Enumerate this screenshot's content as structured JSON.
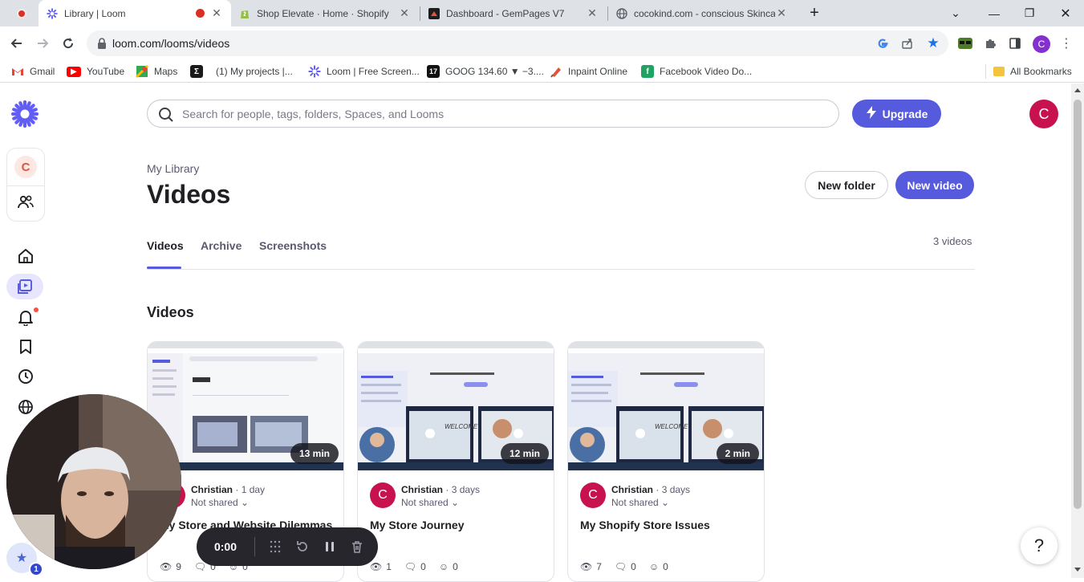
{
  "browser": {
    "tabs": [
      {
        "title": "Library | Loom",
        "active": true,
        "recording": true
      },
      {
        "title": "Shop Elevate · Home · Shopify",
        "active": false
      },
      {
        "title": "Dashboard - GemPages V7",
        "active": false
      },
      {
        "title": "cocokind.com - conscious Skinca",
        "active": false
      }
    ],
    "new_tab": "+",
    "url": "loom.com/looms/videos",
    "profile_initial": "C",
    "bookmarks": [
      {
        "label": "Gmail",
        "icon": "gmail-icon"
      },
      {
        "label": "YouTube",
        "icon": "youtube-icon"
      },
      {
        "label": "Maps",
        "icon": "maps-icon"
      },
      {
        "label": "",
        "icon": "zapier-icon"
      },
      {
        "label": "(1) My projects |...",
        "icon": "projects-icon"
      },
      {
        "label": "Loom | Free Screen...",
        "icon": "loom-icon"
      },
      {
        "label": "GOOG 134.60 ▼ −3....",
        "icon": "ticker-icon"
      },
      {
        "label": "Inpaint Online",
        "icon": "inpaint-icon"
      },
      {
        "label": "Facebook Video Do...",
        "icon": "facebook-icon"
      }
    ],
    "all_bookmarks": "All Bookmarks"
  },
  "app": {
    "workspace_initial": "C",
    "search_placeholder": "Search for people, tags, folders, Spaces, and Looms",
    "upgrade_label": "Upgrade",
    "avatar_initial": "C",
    "breadcrumb": "My Library",
    "title": "Videos",
    "new_folder": "New folder",
    "new_video": "New video",
    "tabs": [
      "Videos",
      "Archive",
      "Screenshots"
    ],
    "video_count": "3 videos",
    "section_title": "Videos",
    "videos": [
      {
        "duration": "13 min",
        "author": "Christian",
        "age": "1 day",
        "sharing": "Not shared",
        "title": "My Store and Website Dilemmas",
        "views": "9",
        "comments": "0",
        "reactions": "0"
      },
      {
        "duration": "12 min",
        "author": "Christian",
        "age": "3 days",
        "sharing": "Not shared",
        "title": "My Store Journey",
        "views": "1",
        "comments": "0",
        "reactions": "0"
      },
      {
        "duration": "2 min",
        "author": "Christian",
        "age": "3 days",
        "sharing": "Not shared",
        "title": "My Shopify Store Issues",
        "views": "7",
        "comments": "0",
        "reactions": "0"
      }
    ],
    "recorder_time": "0:00",
    "help_label": "?",
    "notification_badge": "1",
    "accent_color": "#565add",
    "avatar_color": "#c8124f"
  }
}
